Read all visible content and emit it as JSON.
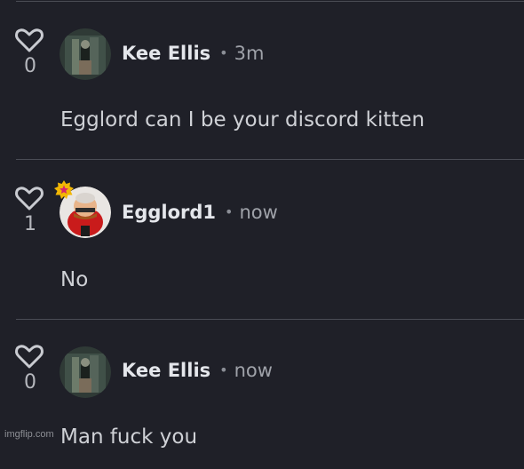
{
  "comments": [
    {
      "votes": "0",
      "username": "Kee Ellis",
      "separator": "•",
      "time": "3m",
      "text": "Egglord can I be your discord kitten",
      "has_badge": false
    },
    {
      "votes": "1",
      "username": "Egglord1",
      "separator": "•",
      "time": "now",
      "text": "No",
      "has_badge": true
    },
    {
      "votes": "0",
      "username": "Kee Ellis",
      "separator": "•",
      "time": "now",
      "text": "Man fuck you",
      "has_badge": false
    }
  ],
  "watermark": "imgflip.com",
  "colors": {
    "background": "#1f2028",
    "divider": "#4a4c55",
    "badge": "#f2b705",
    "badge_star": "#d6246e"
  },
  "icons": {
    "like": "heart-outline-icon",
    "badge": "star-badge-icon"
  }
}
